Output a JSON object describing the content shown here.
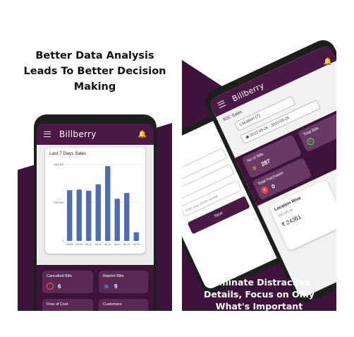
{
  "left": {
    "headline": [
      "Better Data Analysis",
      "Leads To Better Decision",
      "Making"
    ],
    "app": {
      "brand": "Billberry",
      "chart_title": "Last 7 Days Sales",
      "tiles": [
        {
          "label": "Cancelled Bills",
          "value": "6",
          "icon": "clock-icon"
        },
        {
          "label": "Reprint Bills",
          "value": "9",
          "icon": "printer-icon"
        },
        {
          "label": "Free of Cost",
          "value": "",
          "icon": ""
        },
        {
          "label": "Customers",
          "value": "",
          "icon": ""
        }
      ]
    },
    "colors": {
      "purple": "#3d1339",
      "bar": "#4f6eb0",
      "tile": "#5a2a54"
    }
  },
  "chart_data": {
    "type": "bar",
    "title": "Last 7 Days Sales",
    "categories": [
      "06-08",
      "06-09",
      "06-10",
      "06-11",
      "06-12",
      "06-13",
      "06-14",
      "06-15"
    ],
    "values": [
      265000,
      268000,
      262000,
      295000,
      390000,
      220000,
      250000,
      45000
    ],
    "ytick_labels": [
      "0",
      "200,000",
      "400,000"
    ],
    "ylim": [
      0,
      420000
    ],
    "grid": true
  },
  "right": {
    "headline": [
      "Eliminate Distractive",
      "Details, Focus on Only",
      "What's Important"
    ],
    "app": {
      "brand": "Billberry",
      "section": "B2C Sales",
      "location": "Location (7)",
      "date_range": "2022-05-26 - 2022-05-26",
      "tiles": [
        {
          "label": "No of Bills",
          "value": "287"
        },
        {
          "label": "Total Bills",
          "value": ""
        },
        {
          "label": "Total Purchases",
          "value": "0"
        }
      ],
      "location_card": {
        "title": "Location Wise",
        "date": "2022-05-26",
        "amount": "₹ 24361"
      },
      "form": {
        "phone_placeholder": "Enter your phone number",
        "next_label": "Next"
      }
    }
  }
}
